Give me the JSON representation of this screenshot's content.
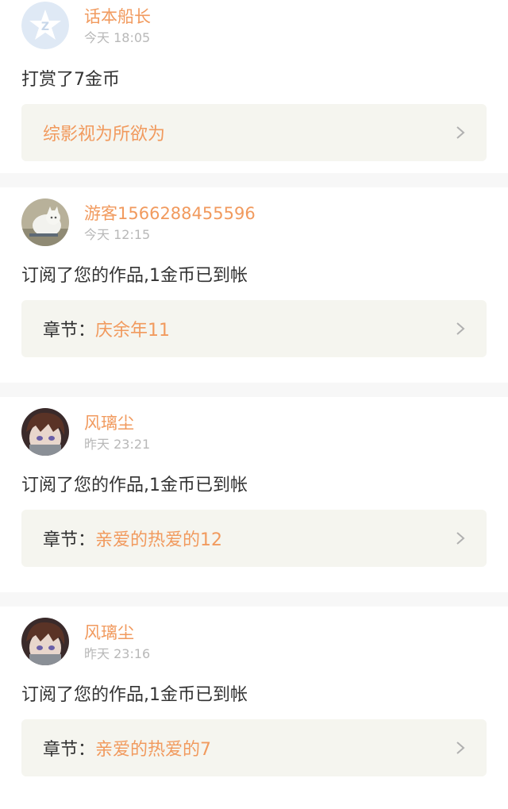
{
  "colors": {
    "accent": "#f19a5e",
    "text": "#333333",
    "muted": "#b8b8b8",
    "box_bg": "#f5f5ef",
    "divider": "#f7f7f7"
  },
  "notifications": [
    {
      "avatar": "qq-avatar",
      "name": "话本船长",
      "time": "今天 18:05",
      "message": "打赏了7金币",
      "link_prefix": "",
      "link_title": "综影视为所欲为"
    },
    {
      "avatar": "cat-avatar",
      "name": "游客1566288455596",
      "time": "今天 12:15",
      "message": "订阅了您的作品,1金币已到帐",
      "link_prefix": "章节：",
      "link_title": "庆余年11"
    },
    {
      "avatar": "anime-avatar",
      "name": "风璃尘",
      "time": "昨天 23:21",
      "message": "订阅了您的作品,1金币已到帐",
      "link_prefix": "章节：",
      "link_title": "亲爱的热爱的12"
    },
    {
      "avatar": "anime-avatar",
      "name": "风璃尘",
      "time": "昨天 23:16",
      "message": "订阅了您的作品,1金币已到帐",
      "link_prefix": "章节：",
      "link_title": "亲爱的热爱的7"
    }
  ]
}
